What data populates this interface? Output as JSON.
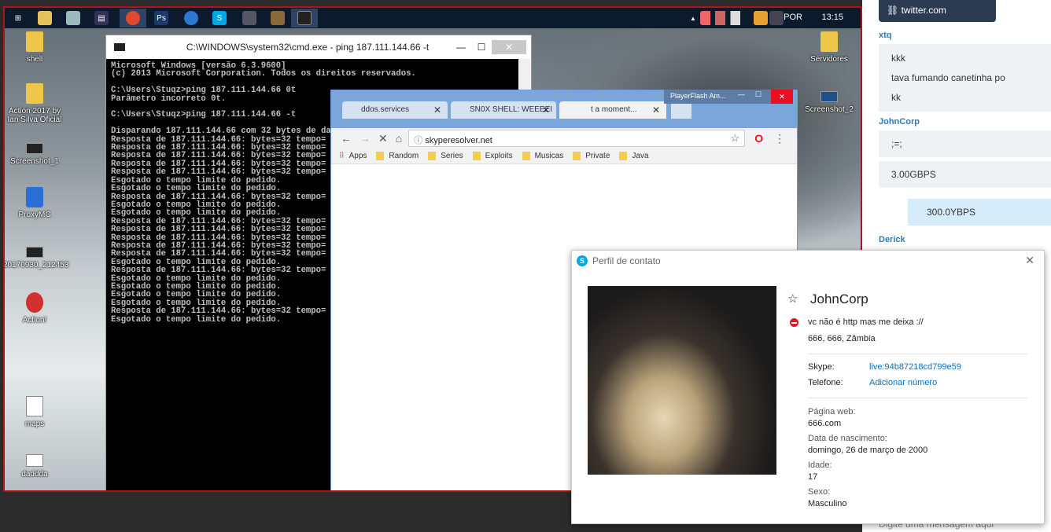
{
  "taskbar": {
    "language": "POR",
    "clock": "13:15"
  },
  "desktop_icons": [
    {
      "label": "shell",
      "kind": "folder"
    },
    {
      "label": "Action 2017 by Ian Silva Oficial",
      "kind": "folder"
    },
    {
      "label": "Screenshot_1",
      "kind": "monitor"
    },
    {
      "label": "ProxyMC",
      "kind": "app"
    },
    {
      "label": "20170930_212453",
      "kind": "monitor"
    },
    {
      "label": "Action!",
      "kind": "app"
    },
    {
      "label": "maps",
      "kind": "doc"
    },
    {
      "label": "daddda",
      "kind": "doc"
    },
    {
      "label": "Servidores",
      "kind": "folder"
    },
    {
      "label": "Screenshot_2",
      "kind": "monitor"
    }
  ],
  "cmd": {
    "title": "C:\\WINDOWS\\system32\\cmd.exe - ping  187.111.144.66 -t",
    "lines": [
      "Microsoft Windows [versão 6.3.9600]",
      "(c) 2013 Microsoft Corporation. Todos os direitos reservados.",
      "",
      "C:\\Users\\Stuqz>ping 187.111.144.66 0t",
      "Parâmetro incorreto 0t.",
      "",
      "C:\\Users\\Stuqz>ping 187.111.144.66 -t",
      "",
      "Disparando 187.111.144.66 com 32 bytes de da",
      "Resposta de 187.111.144.66: bytes=32 tempo=",
      "Resposta de 187.111.144.66: bytes=32 tempo=",
      "Resposta de 187.111.144.66: bytes=32 tempo=",
      "Resposta de 187.111.144.66: bytes=32 tempo=",
      "Resposta de 187.111.144.66: bytes=32 tempo=",
      "Esgotado o tempo limite do pedido.",
      "Esgotado o tempo limite do pedido.",
      "Resposta de 187.111.144.66: bytes=32 tempo=",
      "Esgotado o tempo limite do pedido.",
      "Esgotado o tempo limite do pedido.",
      "Resposta de 187.111.144.66: bytes=32 tempo=",
      "Resposta de 187.111.144.66: bytes=32 tempo=",
      "Resposta de 187.111.144.66: bytes=32 tempo=",
      "Resposta de 187.111.144.66: bytes=32 tempo=",
      "Resposta de 187.111.144.66: bytes=32 tempo=",
      "Esgotado o tempo limite do pedido.",
      "Resposta de 187.111.144.66: bytes=32 tempo=",
      "Esgotado o tempo limite do pedido.",
      "Esgotado o tempo limite do pedido.",
      "Esgotado o tempo limite do pedido.",
      "Esgotado o tempo limite do pedido.",
      "Resposta de 187.111.144.66: bytes=32 tempo=",
      "Esgotado o tempo limite do pedido."
    ]
  },
  "chrome": {
    "tabs": [
      "ddos.services",
      "SN0X SHELL: WEEEEI",
      "t a moment..."
    ],
    "url": "skyperesolver.net",
    "bookmarks": [
      "Apps",
      "Random",
      "Series",
      "Exploits",
      "Musicas",
      "Private",
      "Java"
    ]
  },
  "flash_window": {
    "title": "PlayerFlash Am..."
  },
  "chat": {
    "link": "twitter.com",
    "messages": [
      {
        "sender": "xtq",
        "lines": [
          "kkk",
          "tava fumando canetinha po",
          "kk"
        ]
      },
      {
        "sender": "JohnCorp",
        "lines": [
          ";=;",
          "3.00GBPS"
        ]
      },
      {
        "sender": "",
        "lines": [
          "300.0YBPS"
        ]
      },
      {
        "sender": "Derick",
        "lines": []
      }
    ],
    "input_placeholder": "Digite uma mensagem aqui"
  },
  "profile": {
    "window_title": "Perfil de contato",
    "name": "JohnCorp",
    "status_message": "vc não é http mas me deixa ://",
    "location": "666, 666, Zâmbia",
    "skype_label": "Skype:",
    "skype_value": "live:94b87218cd799e59",
    "phone_label": "Telefone:",
    "phone_value": "Adicionar número",
    "web_label": "Página web:",
    "web_value": "666.com",
    "birth_label": "Data de nascimento:",
    "birth_value": "domingo, 26 de março de 2000",
    "age_label": "Idade:",
    "age_value": "17",
    "sex_label": "Sexo:",
    "sex_value": "Masculino"
  },
  "colors": {
    "accent": "#00a8e8",
    "link": "#0a6ebd",
    "remote_border": "#b3121a",
    "dnd": "#e81123"
  }
}
